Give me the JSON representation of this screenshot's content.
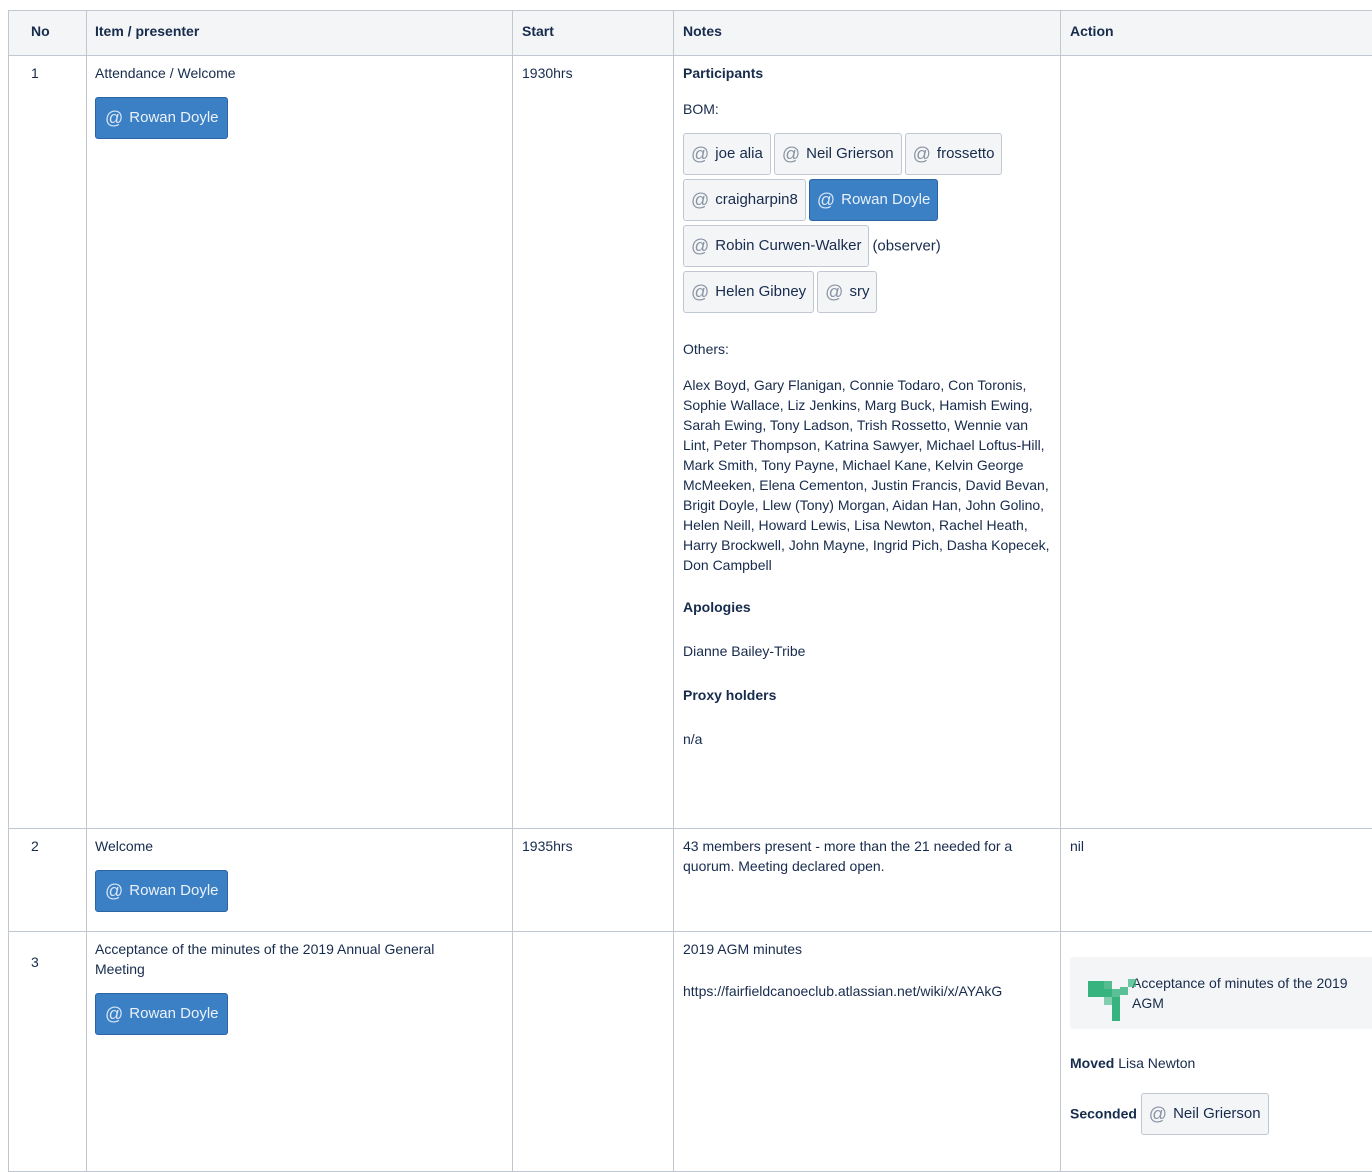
{
  "headers": {
    "no": "No",
    "item": "Item / presenter",
    "start": "Start",
    "notes": "Notes",
    "action": "Action"
  },
  "rows": [
    {
      "no": "1",
      "item": "Attendance / Welcome",
      "presenter": "Rowan Doyle",
      "start": "1930hrs",
      "notes": {
        "participants_heading": "Participants",
        "bom_label": "BOM:",
        "bom_mentions": [
          "joe alia",
          "Neil Grierson",
          "frossetto",
          "craigharpin8",
          "Rowan Doyle",
          "Robin Curwen-Walker",
          "Helen Gibney",
          "sry"
        ],
        "observer_note": "(observer)",
        "others_label": "Others:",
        "others_list": "Alex Boyd, Gary Flanigan, Connie Todaro, Con Toronis, Sophie Wallace, Liz Jenkins, Marg Buck, Hamish Ewing, Sarah Ewing, Tony Ladson, Trish Rossetto, Wennie van Lint, Peter Thompson, Katrina Sawyer, Michael Loftus-Hill, Mark Smith, Tony Payne, Michael Kane, Kelvin George McMeeken, Elena Cementon, Justin Francis, David Bevan, Brigit Doyle, Llew (Tony) Morgan, Aidan Han, John Golino, Helen Neill, Howard Lewis, Lisa Newton, Rachel Heath, Harry Brockwell, John Mayne, Ingrid Pich, Dasha Kopecek, Don Campbell",
        "apologies_heading": "Apologies",
        "apologies": "Dianne Bailey-Tribe",
        "proxy_heading": "Proxy holders",
        "proxy": "n/a"
      },
      "action": ""
    },
    {
      "no": "2",
      "item": "Welcome",
      "presenter": "Rowan Doyle",
      "start": "1935hrs",
      "notes": "43 members present - more than the 21 needed for a quorum. Meeting declared open.",
      "action": "nil"
    },
    {
      "no": "3",
      "item": "Acceptance of the minutes of the 2019 Annual General Meeting",
      "presenter": "Rowan Doyle",
      "start": "",
      "notes_title": "2019 AGM minutes",
      "notes_link": "https://fairfieldcanoeclub.atlassian.net/wiki/x/AYAkG",
      "decision": "Acceptance of minutes of the 2019 AGM",
      "moved_label": "Moved",
      "moved_by": "Lisa Newton",
      "seconded_label": "Seconded",
      "seconded_by": "Neil Grierson"
    }
  ],
  "colors": {
    "header_bg": "#f4f5f7",
    "border": "#c1c7d0",
    "mention_self": "#3b7fc4",
    "decision_icon": "#36b37e"
  },
  "icons": {
    "mention": "at-symbol",
    "decision": "decision-arrow-icon"
  }
}
